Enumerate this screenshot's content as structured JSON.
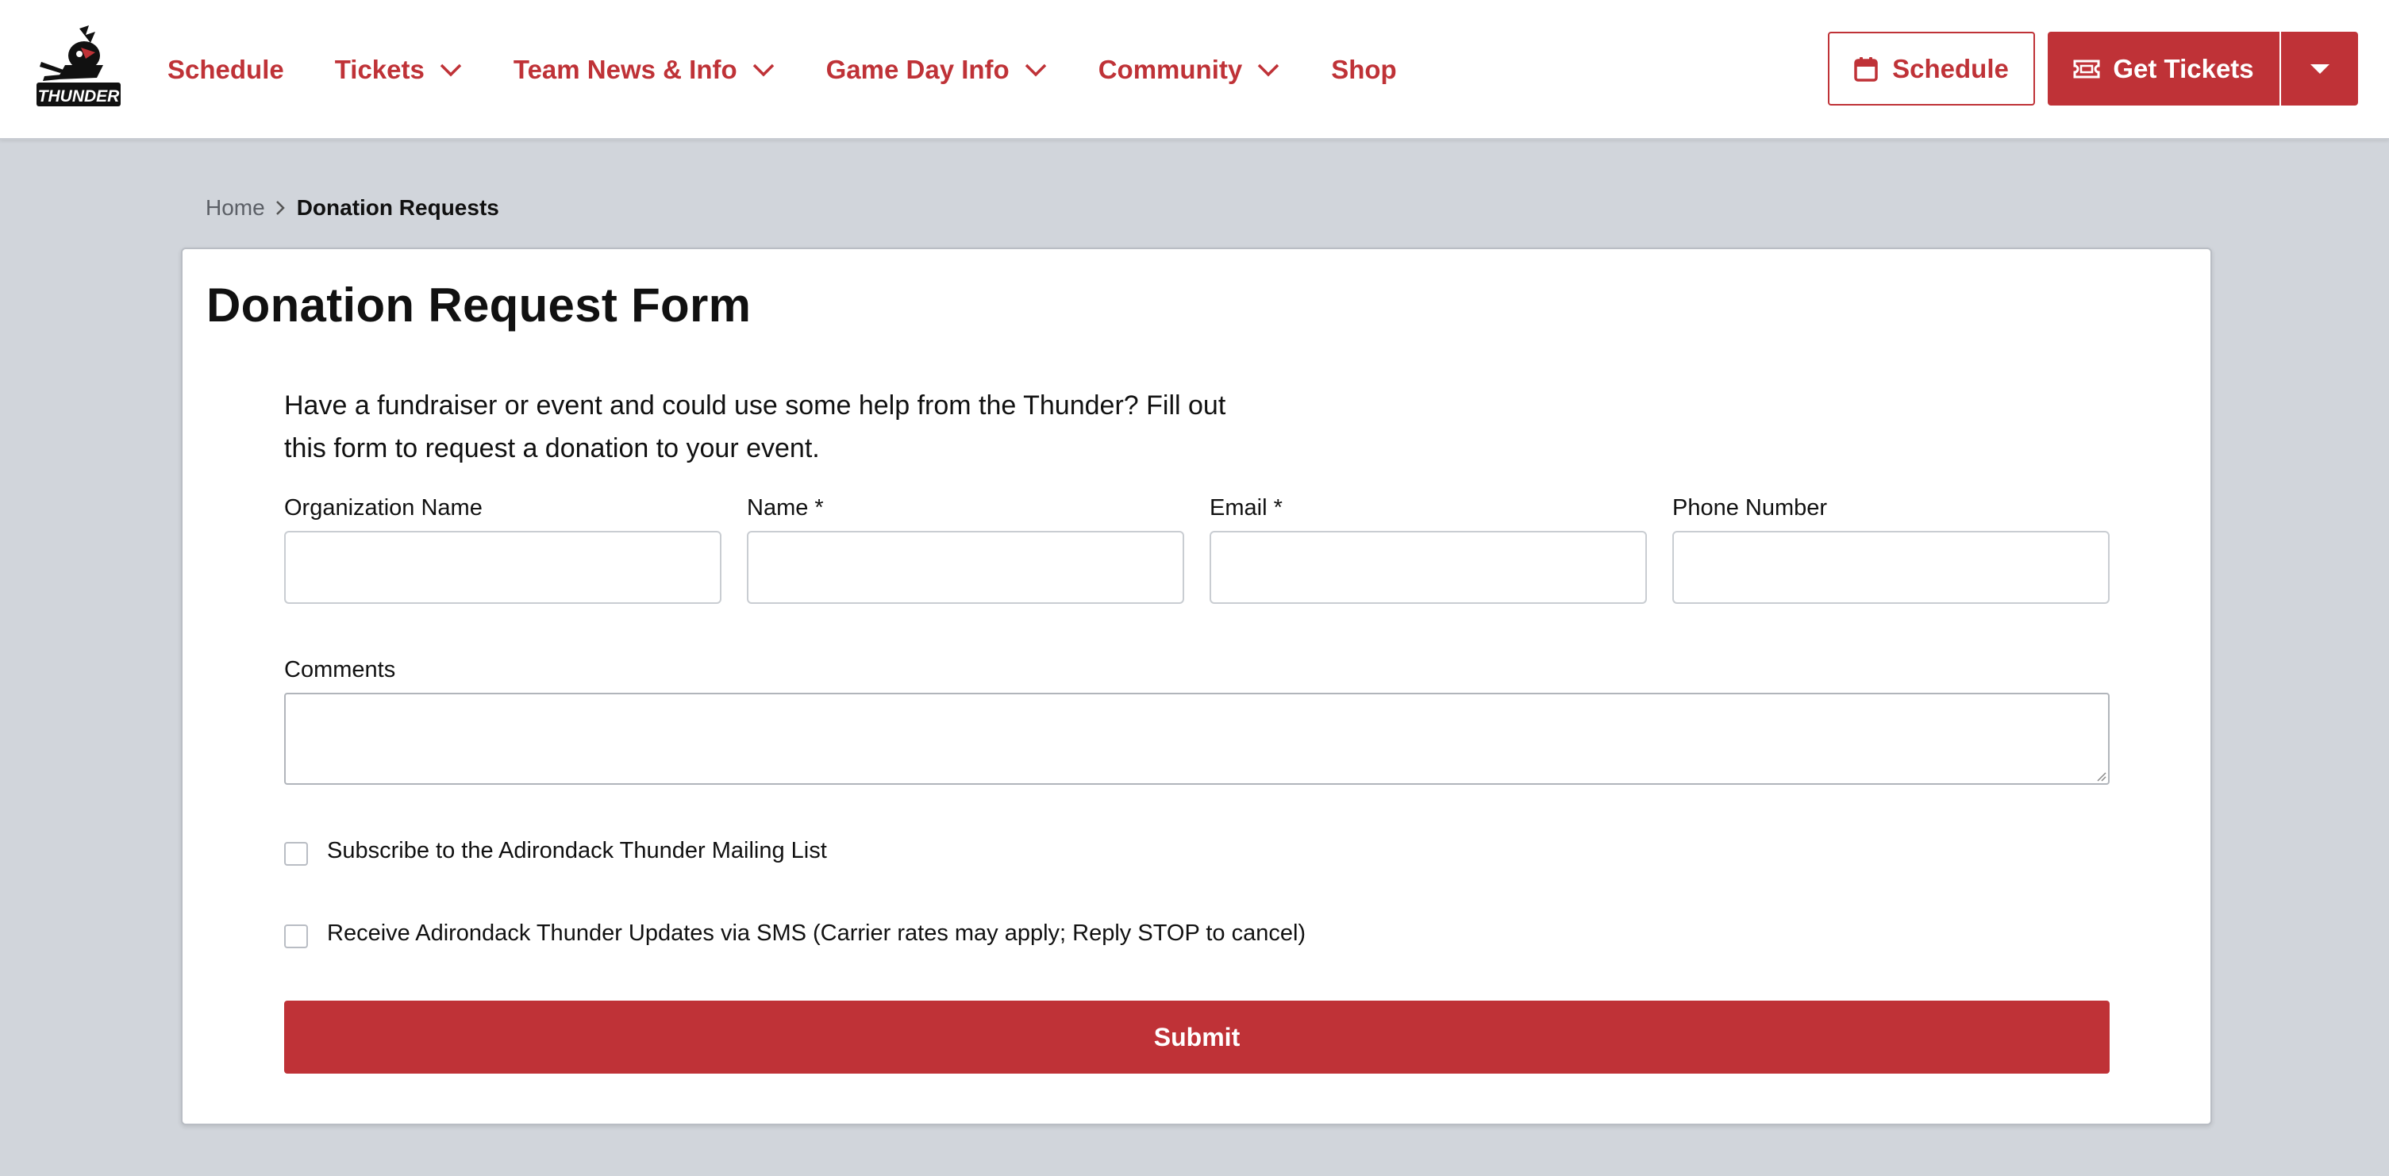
{
  "brand": {
    "logo_alt": "Adirondack Thunder",
    "accent_color": "#bf3237"
  },
  "nav": {
    "items": [
      {
        "label": "Schedule",
        "has_dropdown": false
      },
      {
        "label": "Tickets",
        "has_dropdown": true
      },
      {
        "label": "Team News & Info",
        "has_dropdown": true
      },
      {
        "label": "Game Day Info",
        "has_dropdown": true
      },
      {
        "label": "Community",
        "has_dropdown": true
      },
      {
        "label": "Shop",
        "has_dropdown": false
      }
    ]
  },
  "header_actions": {
    "schedule_label": "Schedule",
    "schedule_icon": "calendar-icon",
    "tickets_label": "Get Tickets",
    "tickets_icon": "ticket-icon"
  },
  "breadcrumb": {
    "home": "Home",
    "current": "Donation Requests"
  },
  "form": {
    "title": "Donation Request Form",
    "intro_line1": "Have a fundraiser or event and could use some help from the Thunder? Fill out",
    "intro_line2": "this form to request a donation to your event.",
    "fields": {
      "organization": {
        "label": "Organization Name",
        "value": ""
      },
      "name": {
        "label": "Name *",
        "value": ""
      },
      "email": {
        "label": "Email *",
        "value": ""
      },
      "phone": {
        "label": "Phone Number",
        "value": ""
      },
      "comments": {
        "label": "Comments",
        "value": ""
      }
    },
    "checkboxes": {
      "mailing_list": {
        "label": "Subscribe to the Adirondack Thunder Mailing List",
        "checked": false
      },
      "sms": {
        "label": "Receive Adirondack Thunder Updates via SMS (Carrier rates may apply; Reply STOP to cancel)",
        "checked": false
      }
    },
    "submit_label": "Submit"
  }
}
